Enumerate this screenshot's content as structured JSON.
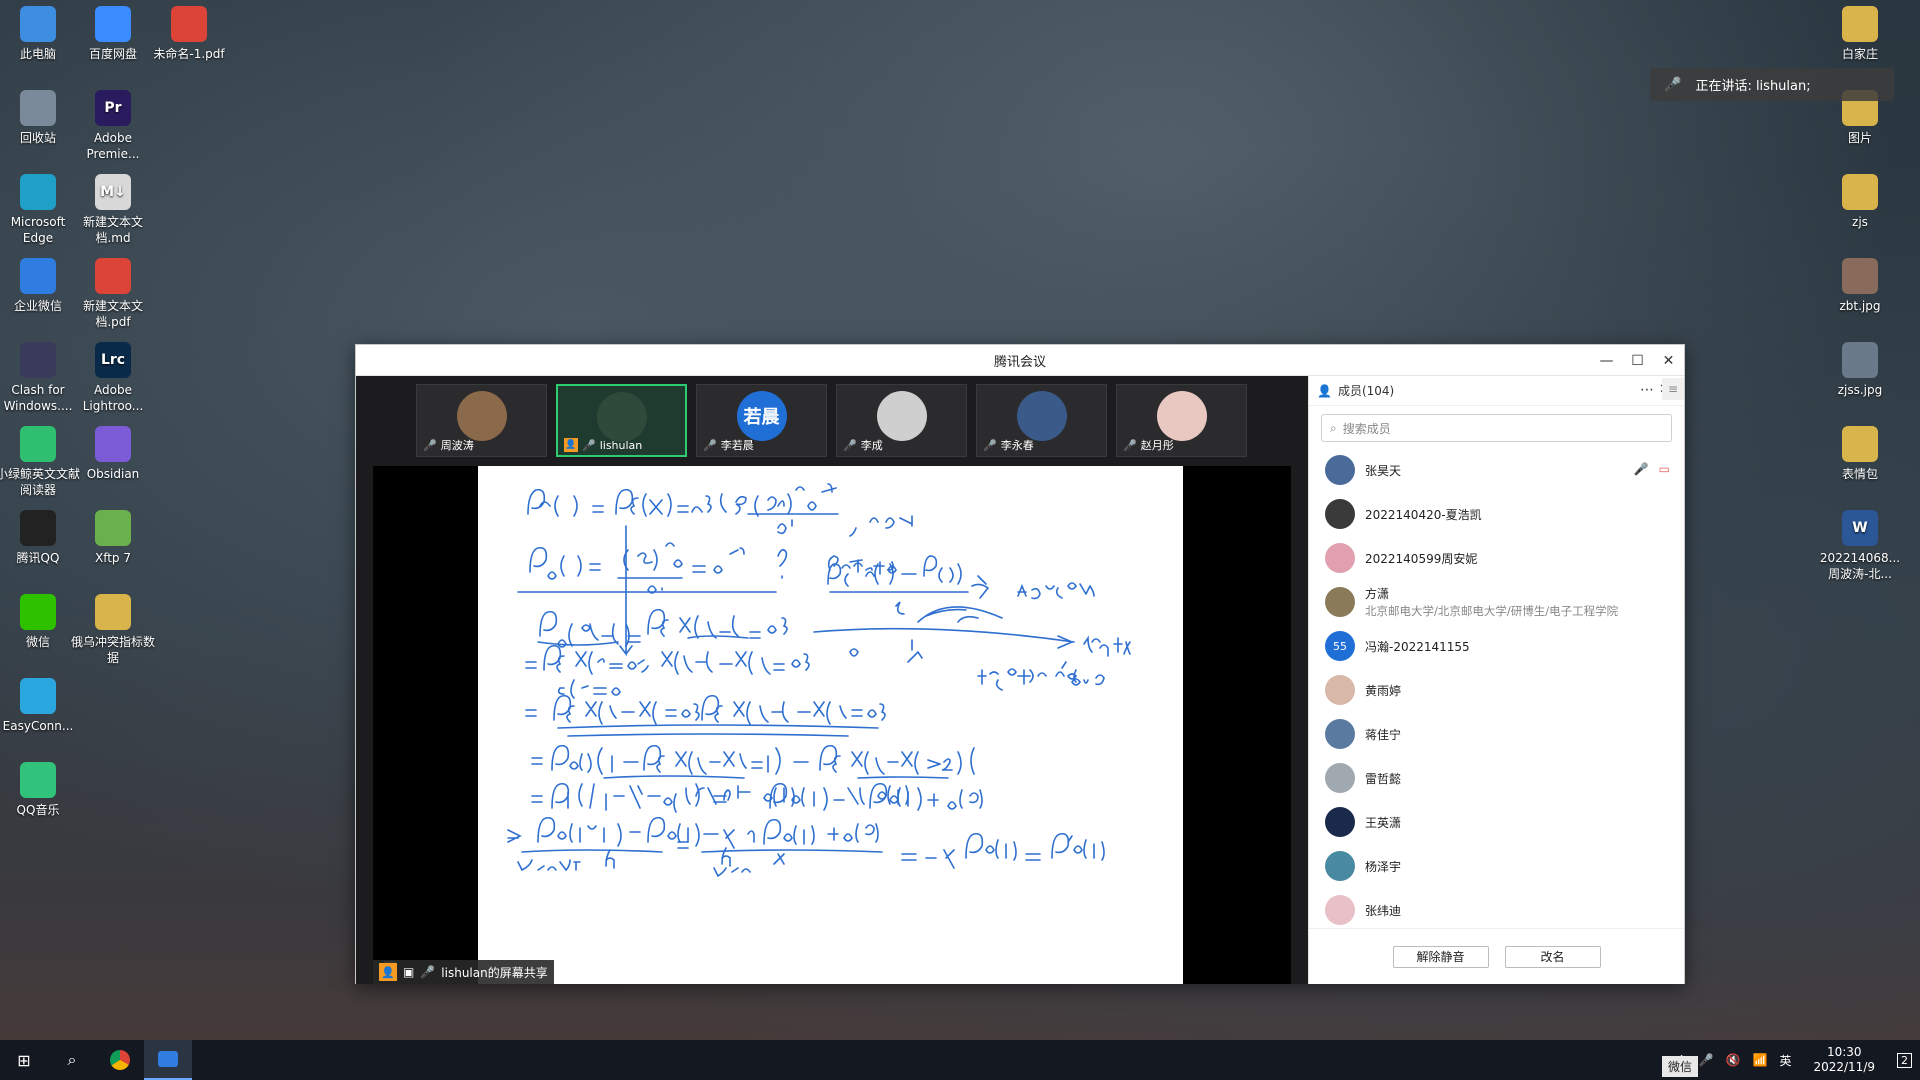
{
  "desktop_left": [
    {
      "label": "此电脑",
      "icon": "computer-icon",
      "color": "#3d8ee0"
    },
    {
      "label": "回收站",
      "icon": "recycle-bin-icon",
      "color": "#7a8a9a"
    },
    {
      "label": "Microsoft Edge",
      "icon": "edge-icon",
      "color": "#1fa0c8"
    },
    {
      "label": "企业微信",
      "icon": "wecom-icon",
      "color": "#2f7de1"
    },
    {
      "label": "Clash for Windows....",
      "icon": "clash-icon",
      "color": "#3a3a5a"
    },
    {
      "label": "小绿鲸英文文献阅读器",
      "icon": "whale-icon",
      "color": "#2fbf71"
    },
    {
      "label": "腾讯QQ",
      "icon": "qq-icon",
      "color": "#222"
    },
    {
      "label": "微信",
      "icon": "wechat-icon",
      "color": "#2dc100"
    },
    {
      "label": "EasyConn...",
      "icon": "easyconnect-icon",
      "color": "#2ba7e0"
    },
    {
      "label": "QQ音乐",
      "icon": "qq-music-icon",
      "color": "#31c27c"
    }
  ],
  "desktop_col2": [
    {
      "label": "百度网盘",
      "icon": "baidu-netdisk-icon",
      "color": "#3b8cff"
    },
    {
      "label": "Adobe Premie...",
      "icon": "premiere-icon",
      "color": "#2a1a5e",
      "glyph": "Pr"
    },
    {
      "label": "新建文本文档.md",
      "icon": "markdown-file-icon",
      "color": "#d8d8d8",
      "glyph": "M↓"
    },
    {
      "label": "新建文本文档.pdf",
      "icon": "chrome-icon",
      "color": "#db4437"
    },
    {
      "label": "Adobe Lightroo...",
      "icon": "lightroom-icon",
      "color": "#0a2a4a",
      "glyph": "Lrc"
    },
    {
      "label": "Obsidian",
      "icon": "obsidian-icon",
      "color": "#7c5cd6"
    },
    {
      "label": "Xftp 7",
      "icon": "xftp-icon",
      "color": "#6ab04c"
    },
    {
      "label": "俄乌冲突指标数据",
      "icon": "zip-file-icon",
      "color": "#d9b44a"
    }
  ],
  "desktop_col3": [
    {
      "label": "未命名-1.pdf",
      "icon": "chrome-icon",
      "color": "#db4437"
    }
  ],
  "desktop_right": [
    {
      "label": "白家庄",
      "icon": "zip-file-icon",
      "color": "#d9b44a"
    },
    {
      "label": "图片",
      "icon": "zip-file-icon",
      "color": "#d9b44a"
    },
    {
      "label": "zjs",
      "icon": "zip-file-icon",
      "color": "#d9b44a"
    },
    {
      "label": "zbt.jpg",
      "icon": "photo-file-icon",
      "color": "#8a6a5a"
    },
    {
      "label": "zjss.jpg",
      "icon": "photo-file-icon",
      "color": "#6a7a8a"
    },
    {
      "label": "表情包",
      "icon": "zip-file-icon",
      "color": "#d9b44a"
    },
    {
      "label": "202214068...周波涛-北...",
      "icon": "word-file-icon",
      "color": "#2b5797",
      "glyph": "W"
    }
  ],
  "speaker": {
    "text": "正在讲话: lishulan;"
  },
  "meeting": {
    "title": "腾讯会议",
    "thumbs": [
      {
        "name": "周波涛",
        "avatar_color": "#8a6a4a",
        "avatar_text": "",
        "muted": true
      },
      {
        "name": "lishulan",
        "avatar_color": "#2f4a3a",
        "avatar_text": "",
        "muted": false,
        "active": true
      },
      {
        "name": "李若晨",
        "avatar_color": "#1f6fd6",
        "avatar_text": "若晨",
        "muted": true
      },
      {
        "name": "李成",
        "avatar_color": "#cfcfcf",
        "avatar_text": "",
        "muted": true
      },
      {
        "name": "李永春",
        "avatar_color": "#3a5a8a",
        "avatar_text": "",
        "muted": true
      },
      {
        "name": "赵月彤",
        "avatar_color": "#e8c8c0",
        "avatar_text": "",
        "muted": true
      }
    ],
    "share_label": "lishulan的屏幕共享"
  },
  "members": {
    "header": "成员(104)",
    "search_placeholder": "搜索成员",
    "list": [
      {
        "name": "张昊天",
        "color": "#4a6a9a"
      },
      {
        "name": "2022140420-夏浩凯",
        "color": "#3a3a3a"
      },
      {
        "name": "2022140599周安妮",
        "color": "#e0a0b0"
      },
      {
        "name": "方潇",
        "sub": "北京邮电大学/北京邮电大学/研博生/电子工程学院",
        "color": "#8a7a5a"
      },
      {
        "name": "冯瀚-2022141155",
        "color": "#1f6fd6",
        "avatar_text": "55"
      },
      {
        "name": "黄雨婷",
        "color": "#d8b8a8"
      },
      {
        "name": "蒋佳宁",
        "color": "#5a7aa0"
      },
      {
        "name": "雷哲懿",
        "color": "#a0a8b0"
      },
      {
        "name": "王英潇",
        "color": "#1a2a4a"
      },
      {
        "name": "杨泽宇",
        "color": "#4a8aa0"
      },
      {
        "name": "张纬迪",
        "color": "#e8c0c8"
      }
    ],
    "unmute_button": "解除静音",
    "rename_button": "改名"
  },
  "taskbar": {
    "time": "10:30",
    "date": "2022/11/9",
    "ime": "英",
    "notifications": "2",
    "wechat_tip": "微信"
  }
}
